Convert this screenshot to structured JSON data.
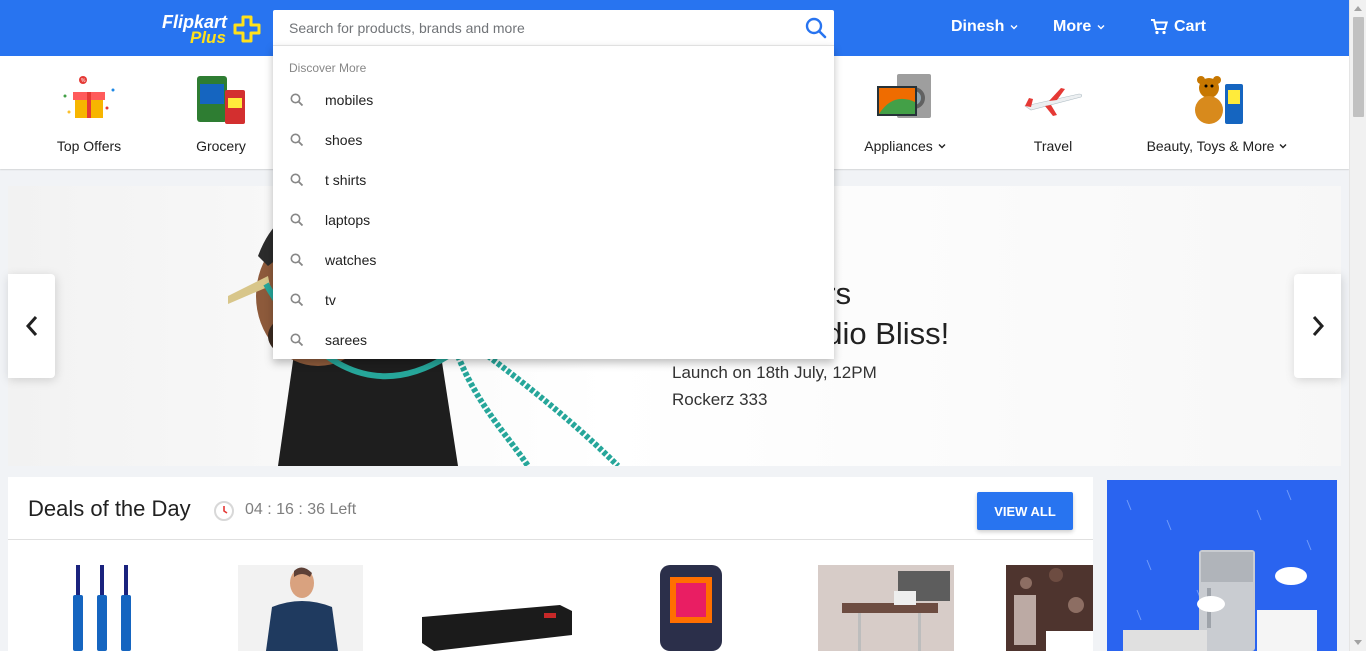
{
  "header": {
    "logo_primary": "Flipkart",
    "logo_secondary": "Plus",
    "user_label": "Dinesh",
    "more_label": "More",
    "cart_label": "Cart",
    "brand_color": "#2874f0"
  },
  "search": {
    "placeholder": "Search for products, brands and more",
    "value": "",
    "dropdown_heading": "Discover More",
    "suggestions": [
      "mobiles",
      "shoes",
      "t shirts",
      "laptops",
      "watches",
      "tv",
      "sarees"
    ]
  },
  "categories": [
    {
      "label": "Top Offers",
      "icon": "offers-icon"
    },
    {
      "label": "Grocery",
      "icon": "grocery-icon"
    },
    {
      "label": "Appliances",
      "icon": "appliances-icon",
      "has_dropdown": true
    },
    {
      "label": "Travel",
      "icon": "airplane-icon"
    },
    {
      "label": "Beauty, Toys & More",
      "icon": "teddy-icon",
      "has_dropdown": true
    }
  ],
  "banner": {
    "headline_1": "urs",
    "headline_2": "udio Bliss!",
    "sub_1": "Launch on 18th July, 12PM",
    "sub_2": "Rockerz 333"
  },
  "deals": {
    "title": "Deals of the Day",
    "timer": "04 : 16 : 36 Left",
    "view_all_label": "VIEW ALL"
  }
}
